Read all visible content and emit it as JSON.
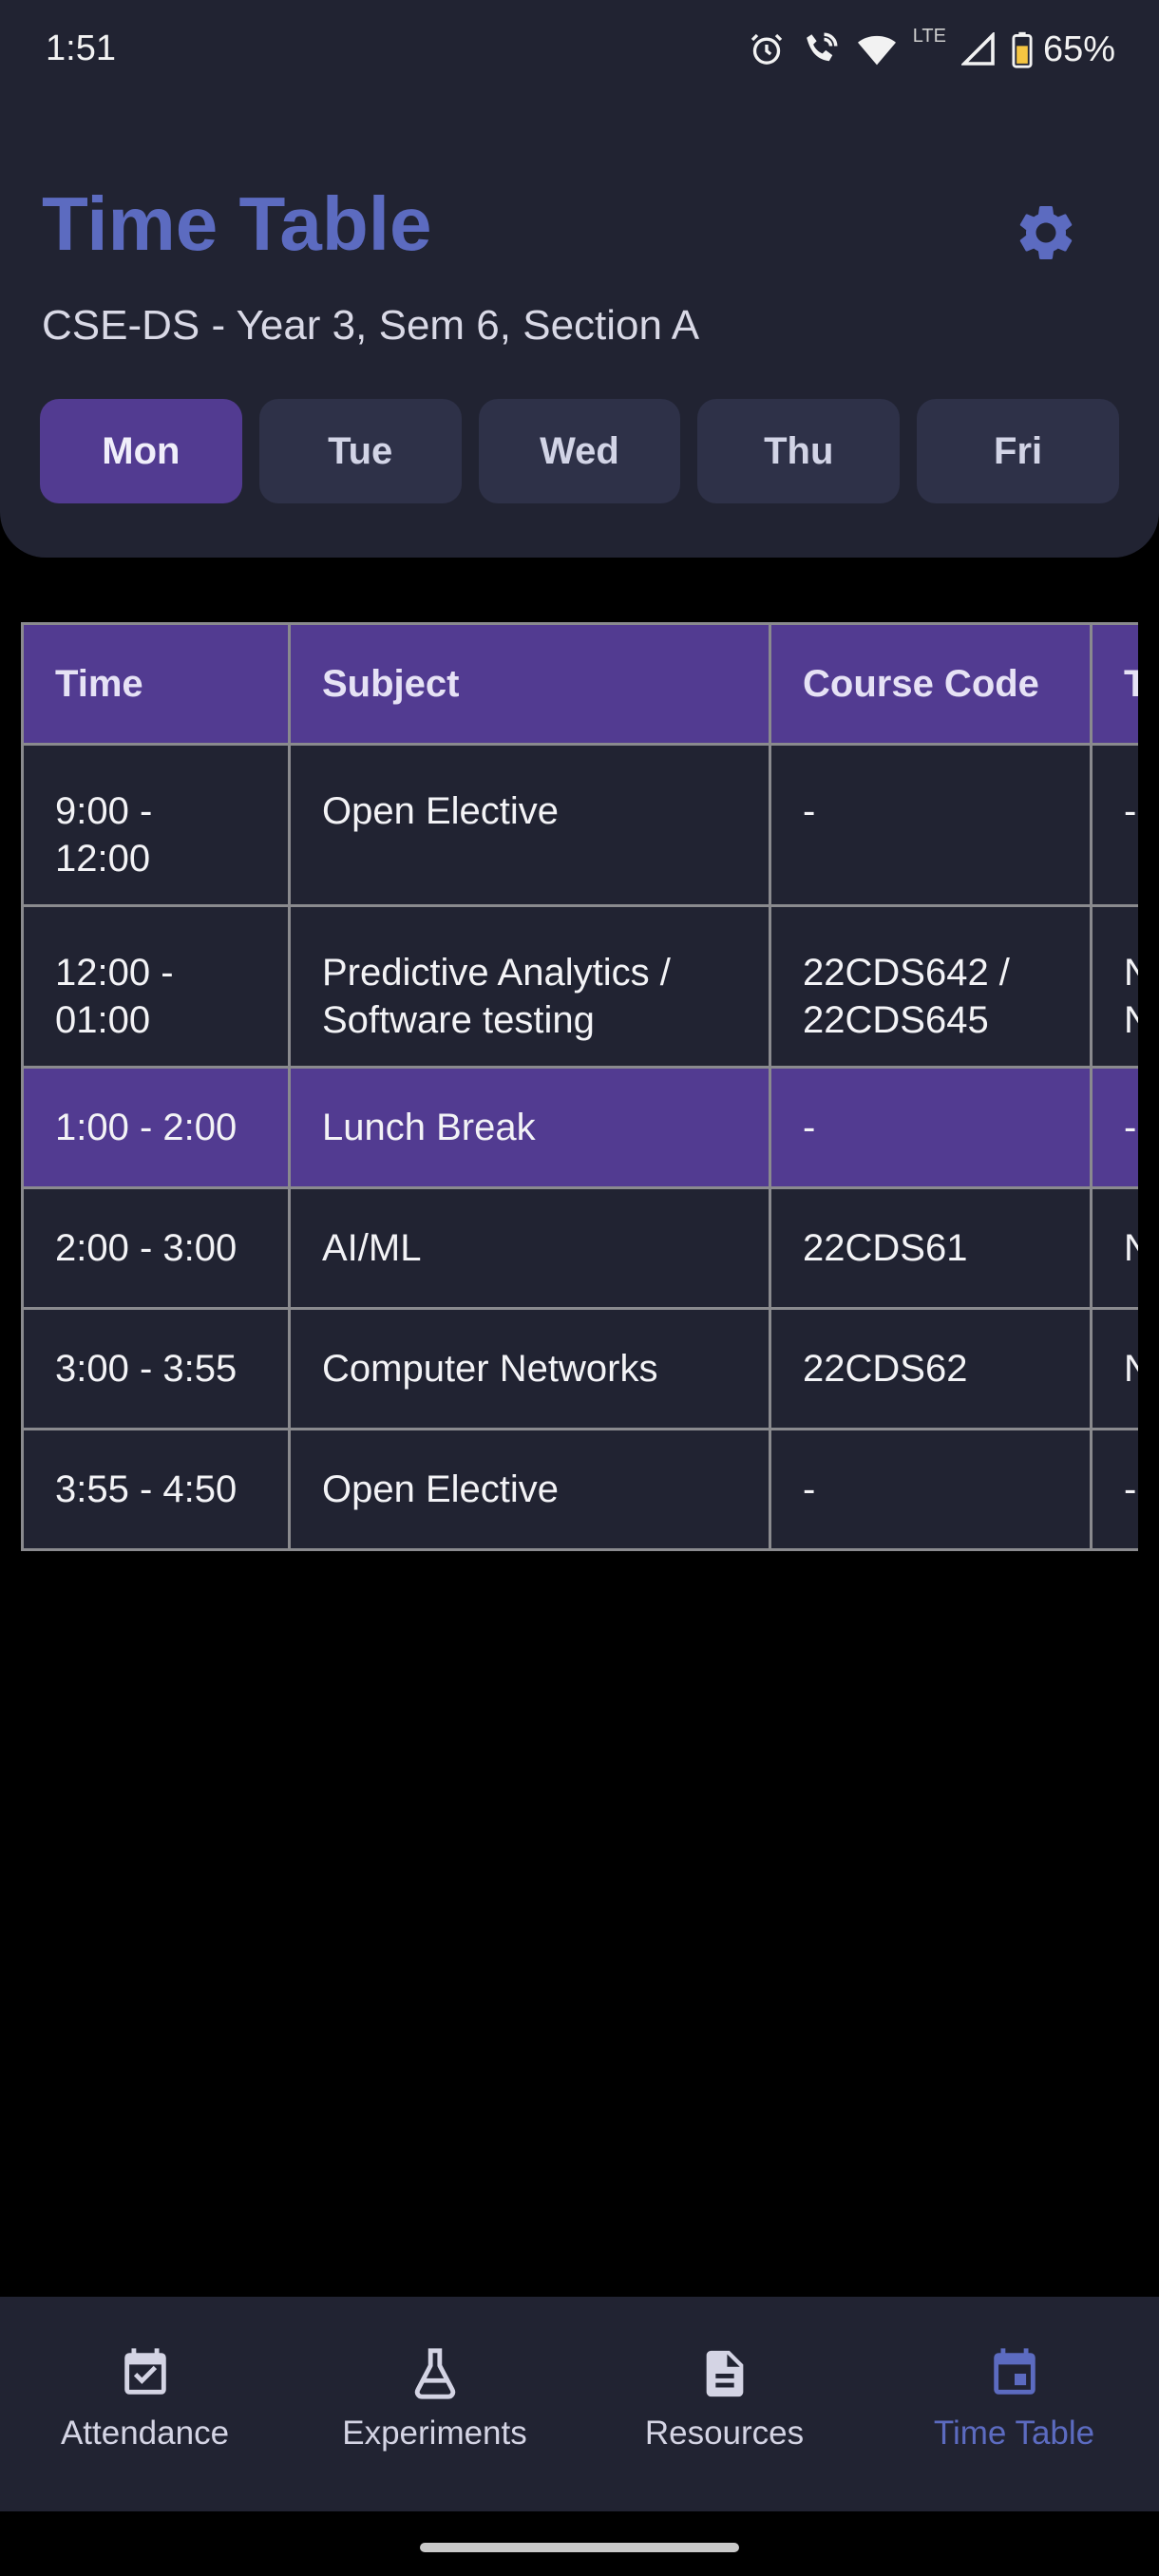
{
  "status_bar": {
    "time": "1:51",
    "network_label": "LTE",
    "battery": "65%"
  },
  "header": {
    "title": "Time Table",
    "subtitle": "CSE-DS - Year 3, Sem 6, Section A",
    "settings_icon": "gear-icon",
    "accent_color": "#5c6bc0"
  },
  "days": [
    {
      "label": "Mon",
      "active": true
    },
    {
      "label": "Tue",
      "active": false
    },
    {
      "label": "Wed",
      "active": false
    },
    {
      "label": "Thu",
      "active": false
    },
    {
      "label": "Fri",
      "active": false
    }
  ],
  "table": {
    "columns": [
      "Time",
      "Subject",
      "Course Code",
      "T"
    ],
    "rows": [
      {
        "time": "9:00 - 12:00",
        "subject": "Open Elective",
        "code": "-",
        "extra": "-"
      },
      {
        "time": "12:00 - 01:00",
        "subject": "Predictive Analytics / Software testing",
        "code": "22CDS642 / 22CDS645",
        "extra": "N\nN"
      },
      {
        "time": "1:00 - 2:00",
        "subject": "Lunch Break",
        "code": "-",
        "extra": "-"
      },
      {
        "time": "2:00 - 3:00",
        "subject": "AI/ML",
        "code": "22CDS61",
        "extra": "N"
      },
      {
        "time": "3:00 - 3:55",
        "subject": "Computer Networks",
        "code": "22CDS62",
        "extra": "N"
      },
      {
        "time": "3:55 - 4:50",
        "subject": "Open Elective",
        "code": "-",
        "extra": "-"
      }
    ],
    "header_color": "#523b91"
  },
  "nav": [
    {
      "label": "Attendance",
      "icon": "calendar-check-icon",
      "active": false
    },
    {
      "label": "Experiments",
      "icon": "flask-icon",
      "active": false
    },
    {
      "label": "Resources",
      "icon": "document-icon",
      "active": false
    },
    {
      "label": "Time Table",
      "icon": "calendar-icon",
      "active": true
    }
  ]
}
